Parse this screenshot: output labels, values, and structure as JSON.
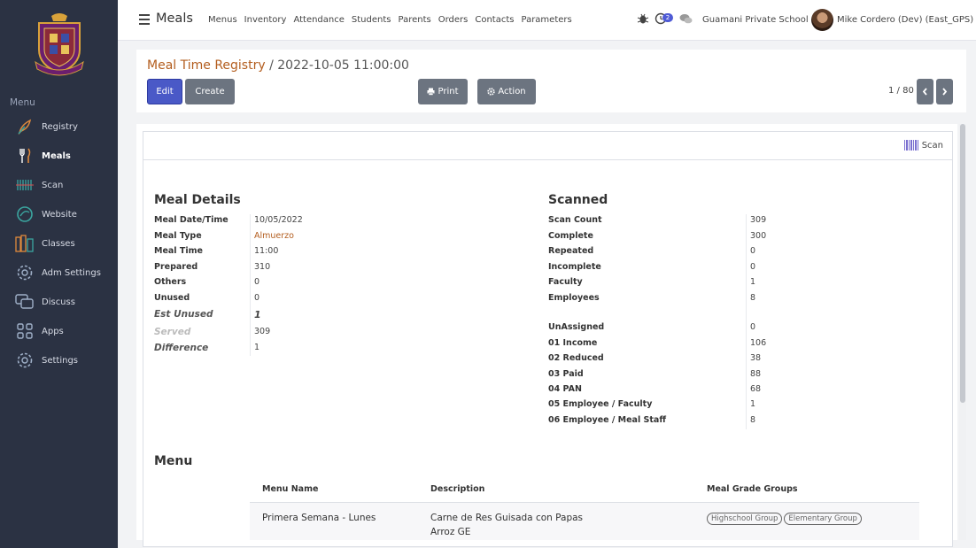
{
  "sidebar": {
    "menu_title": "Menu",
    "items": [
      {
        "label": "Registry",
        "icon": "feather-icon"
      },
      {
        "label": "Meals",
        "icon": "fork-knife-icon"
      },
      {
        "label": "Scan",
        "icon": "barcode-icon"
      },
      {
        "label": "Website",
        "icon": "globe-icon"
      },
      {
        "label": "Classes",
        "icon": "books-icon"
      },
      {
        "label": "Adm Settings",
        "icon": "gear-icon"
      },
      {
        "label": "Discuss",
        "icon": "chat-icon"
      },
      {
        "label": "Apps",
        "icon": "grid-icon"
      },
      {
        "label": "Settings",
        "icon": "gear-icon"
      }
    ]
  },
  "topbar": {
    "app_title": "Meals",
    "nav": [
      "Menus",
      "Inventory",
      "Attendance",
      "Students",
      "Parents",
      "Orders",
      "Contacts",
      "Parameters"
    ],
    "activity_count": "2",
    "company": "Guamani Private School",
    "user": "Mike Cordero (Dev) (East_GPS)"
  },
  "control": {
    "breadcrumb_parent": "Meal Time Registry",
    "breadcrumb_sep": "/",
    "breadcrumb_current": "2022-10-05 11:00:00",
    "edit": "Edit",
    "create": "Create",
    "print": "Print",
    "action": "Action",
    "pager": "1 / 80"
  },
  "form": {
    "scan_button": "Scan",
    "details_title": "Meal Details",
    "details": [
      {
        "label": "Meal Date/Time",
        "value": "10/05/2022"
      },
      {
        "label": "Meal Type",
        "value": "Almuerzo"
      },
      {
        "label": "Meal Time",
        "value": "11:00"
      },
      {
        "label": "Prepared",
        "value": "310"
      },
      {
        "label": "Others",
        "value": "0"
      },
      {
        "label": "Unused",
        "value": "0"
      },
      {
        "label": "Est Unused",
        "value": "1"
      },
      {
        "label": "Served",
        "value": "309"
      },
      {
        "label": "Difference",
        "value": "1"
      }
    ],
    "scanned_title": "Scanned",
    "scanned": [
      {
        "label": "Scan Count",
        "value": "309"
      },
      {
        "label": "Complete",
        "value": "300"
      },
      {
        "label": "Repeated",
        "value": "0"
      },
      {
        "label": "Incomplete",
        "value": "0"
      },
      {
        "label": "Faculty",
        "value": "1"
      },
      {
        "label": "Employees",
        "value": "8"
      }
    ],
    "groups": [
      {
        "label": "UnAssigned",
        "value": "0"
      },
      {
        "label": "01 Income",
        "value": "106"
      },
      {
        "label": "02 Reduced",
        "value": "38"
      },
      {
        "label": "03 Paid",
        "value": "88"
      },
      {
        "label": "04 PAN",
        "value": "68"
      },
      {
        "label": "05 Employee / Faculty",
        "value": "1"
      },
      {
        "label": "06 Employee / Meal Staff",
        "value": "8"
      }
    ],
    "menu_title": "Menu",
    "menu_table": {
      "headers": [
        "Menu Name",
        "Description",
        "Meal Grade Groups"
      ],
      "rows": [
        {
          "name": "Primera Semana - Lunes",
          "description_line1": "Carne de Res Guisada con Papas",
          "description_line2": "Arroz GE",
          "tags": [
            "Highschool Group",
            "Elementary Group"
          ]
        }
      ]
    }
  },
  "colors": {
    "sidebar_bg": "#2b3243",
    "primary": "#4a59c7",
    "secondary": "#6c7480",
    "link": "#b35d1e"
  }
}
